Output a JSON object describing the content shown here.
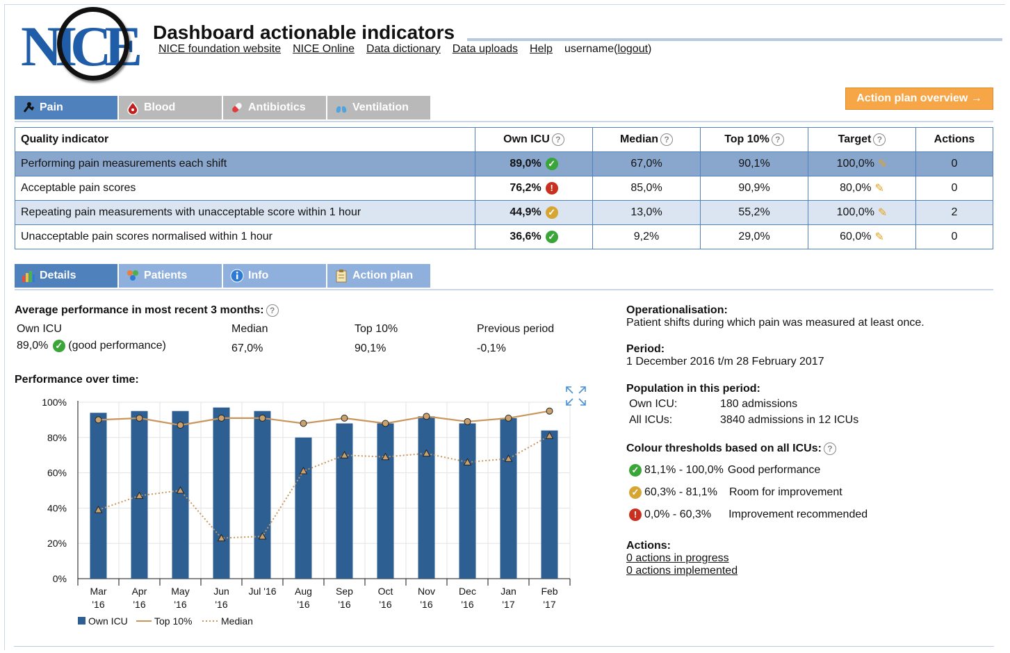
{
  "header": {
    "logo_text": "NICE",
    "title": "Dashboard actionable indicators",
    "links": [
      "NICE foundation website",
      "NICE Online",
      "Data dictionary",
      "Data uploads",
      "Help"
    ],
    "user": "username(",
    "logout": "logout",
    "user_close": ")"
  },
  "topic_tabs": [
    {
      "label": "Pain",
      "icon": "pain-icon",
      "active": true
    },
    {
      "label": "Blood",
      "icon": "blood-drop-icon",
      "active": false
    },
    {
      "label": "Antibiotics",
      "icon": "pill-icon",
      "active": false
    },
    {
      "label": "Ventilation",
      "icon": "lungs-icon",
      "active": false
    }
  ],
  "action_plan_button": "Action plan overview →",
  "table": {
    "headers": [
      "Quality indicator",
      "Own ICU",
      "Median",
      "Top 10%",
      "Target",
      "Actions"
    ],
    "rows": [
      {
        "indicator": "Performing pain measurements each shift",
        "own": "89,0%",
        "status": "good",
        "median": "67,0%",
        "top": "90,1%",
        "target": "100,0%",
        "actions": "0"
      },
      {
        "indicator": "Acceptable pain scores",
        "own": "76,2%",
        "status": "bad",
        "median": "85,0%",
        "top": "90,9%",
        "target": "80,0%",
        "actions": "0"
      },
      {
        "indicator": "Repeating pain measurements with unacceptable score within 1 hour",
        "own": "44,9%",
        "status": "room",
        "median": "13,0%",
        "top": "55,2%",
        "target": "100,0%",
        "actions": "2"
      },
      {
        "indicator": "Unacceptable pain scores normalised within 1 hour",
        "own": "36,6%",
        "status": "good",
        "median": "9,2%",
        "top": "29,0%",
        "target": "60,0%",
        "actions": "0"
      }
    ]
  },
  "detail_tabs": [
    {
      "label": "Details",
      "icon": "bar-chart-icon",
      "active": true
    },
    {
      "label": "Patients",
      "icon": "patients-icon",
      "active": false
    },
    {
      "label": "Info",
      "icon": "info-icon",
      "active": false
    },
    {
      "label": "Action plan",
      "icon": "clipboard-icon",
      "active": false
    }
  ],
  "average": {
    "heading": "Average performance in most recent 3 months:",
    "own_label": "Own ICU",
    "own_value": "89,0%",
    "own_note": "(good performance)",
    "median_label": "Median",
    "median_value": "67,0%",
    "top_label": "Top 10%",
    "top_value": "90,1%",
    "prev_label": "Previous period",
    "prev_value": "-0,1%"
  },
  "performance_heading": "Performance over time:",
  "chart_data": {
    "type": "bar",
    "categories": [
      "Mar '16",
      "Apr '16",
      "May '16",
      "Jun '16",
      "Jul '16",
      "Aug '16",
      "Sep '16",
      "Oct '16",
      "Nov '16",
      "Dec '16",
      "Jan '17",
      "Feb '17"
    ],
    "category_lines": [
      [
        "Mar",
        "'16"
      ],
      [
        "Apr",
        "'16"
      ],
      [
        "May",
        "'16"
      ],
      [
        "Jun",
        "'16"
      ],
      [
        "Jul '16"
      ],
      [
        "Aug",
        "'16"
      ],
      [
        "Sep",
        "'16"
      ],
      [
        "Oct",
        "'16"
      ],
      [
        "Nov",
        "'16"
      ],
      [
        "Dec",
        "'16"
      ],
      [
        "Jan",
        "'17"
      ],
      [
        "Feb",
        "'17"
      ]
    ],
    "series": [
      {
        "name": "Own ICU",
        "type": "bar",
        "color": "#2e5f93",
        "values": [
          94,
          95,
          95,
          97,
          95,
          80,
          88,
          88,
          92,
          88,
          91,
          84
        ]
      },
      {
        "name": "Top 10%",
        "type": "line",
        "color": "#c8955a",
        "values": [
          90,
          91,
          87,
          91,
          91,
          88,
          91,
          88,
          92,
          89,
          91,
          95
        ]
      },
      {
        "name": "Median",
        "type": "line-dotted",
        "color": "#c8955a",
        "values": [
          39,
          47,
          50,
          23,
          24,
          61,
          70,
          69,
          71,
          66,
          68,
          81
        ]
      }
    ],
    "ylim": [
      0,
      100
    ],
    "yticks": [
      "0%",
      "20%",
      "40%",
      "60%",
      "80%",
      "100%"
    ],
    "grid": true,
    "legend": "bottom-left"
  },
  "right_panel": {
    "op_label": "Operationalisation:",
    "op_text": "Patient shifts during which pain was measured at least once.",
    "period_label": "Period:",
    "period_text": "1 December 2016 t/m 28 February 2017",
    "pop_label": "Population in this period:",
    "pop_own_label": "Own ICU:",
    "pop_own_value": "180 admissions",
    "pop_all_label": "All ICUs:",
    "pop_all_value": "3840 admissions in 12 ICUs",
    "thr_label": "Colour thresholds based on all ICUs:",
    "thresholds": [
      {
        "range": "81,1% - 100,0%",
        "text": "Good performance",
        "status": "good"
      },
      {
        "range": "60,3% - 81,1%",
        "text": "Room for improvement",
        "status": "room"
      },
      {
        "range": "0,0% - 60,3%",
        "text": "Improvement recommended",
        "status": "bad"
      }
    ],
    "actions_label": "Actions:",
    "actions_links": [
      "0 actions in progress",
      "0 actions implemented"
    ]
  },
  "colors": {
    "accent": "#4f81bd",
    "good": "#3aa538",
    "room": "#d7a531",
    "bad": "#c9301f",
    "button": "#f6a647"
  }
}
